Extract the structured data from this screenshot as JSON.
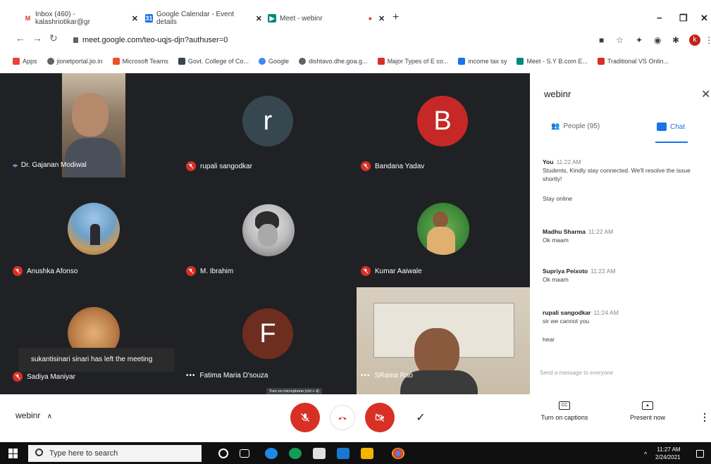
{
  "browser": {
    "tabs": [
      {
        "label": "Inbox (460) - kalashriotikar@gr",
        "icon": "gmail-icon"
      },
      {
        "label": "Google Calendar - Event details",
        "icon": "calendar-icon"
      },
      {
        "label": "Meet - webinr",
        "icon": "meet-icon"
      }
    ],
    "url": "meet.google.com/teo-uqjs-djn?authuser=0",
    "profile_initial": "k",
    "bookmarks": [
      "Apps",
      "jionetportal.jio.in",
      "Microsoft Teams",
      "Govt. College of Co...",
      "Google",
      "dishtavo.dhe.goa.g...",
      "Major Types of E co...",
      "income tax sy",
      "Meet - S.Y B.com E...",
      "Traditional VS Onlin..."
    ]
  },
  "stage": {
    "participants": [
      {
        "name": "Dr. Gajanan Modiwal",
        "state": "speaking",
        "kind": "video"
      },
      {
        "name": "rupali sangodkar",
        "state": "muted",
        "kind": "initial",
        "initial": "r",
        "color": "#37474f"
      },
      {
        "name": "Bandana Yadav",
        "state": "muted",
        "kind": "initial",
        "initial": "B",
        "color": "#c62828"
      },
      {
        "name": "Anushka Afonso",
        "state": "muted",
        "kind": "photo"
      },
      {
        "name": "M. Ibrahim",
        "state": "muted",
        "kind": "photo"
      },
      {
        "name": "Kumar Aaiwale",
        "state": "muted",
        "kind": "photo"
      },
      {
        "name": "Sadiya Maniyar",
        "state": "muted",
        "kind": "photo"
      },
      {
        "name": "Fatima Maria D'souza",
        "state": "more",
        "kind": "initial",
        "initial": "F",
        "color": "#6d2e1f"
      },
      {
        "name": "SRama Rao",
        "state": "more",
        "kind": "video"
      }
    ],
    "toast": "sukantisinari sinari has left the meeting",
    "mic_tooltip": "Turn on microphone (ctrl + d)"
  },
  "panel": {
    "title": "webinr",
    "tabs": {
      "people": "People (95)",
      "chat": "Chat"
    },
    "messages": [
      {
        "sender": "You",
        "time": "11:22 AM",
        "lines": [
          "Students, Kindly stay connected. We'll resolve the issue shortly!",
          "Stay online"
        ]
      },
      {
        "sender": "Madhu Sharma",
        "time": "11:22 AM",
        "lines": [
          "Ok maam"
        ]
      },
      {
        "sender": "Supriya Peixoto",
        "time": "11:22 AM",
        "lines": [
          "Ok maam"
        ]
      },
      {
        "sender": "rupali sangodkar",
        "time": "11:24 AM",
        "lines": [
          "sir we cannot you",
          "hear"
        ]
      }
    ],
    "send_placeholder": "Send a message to everyone"
  },
  "bottombar": {
    "meeting_name": "webinr",
    "captions": "Turn on captions",
    "present": "Present now"
  },
  "taskbar": {
    "search_placeholder": "Type here to search",
    "time": "11:27 AM",
    "date": "2/24/2021"
  }
}
